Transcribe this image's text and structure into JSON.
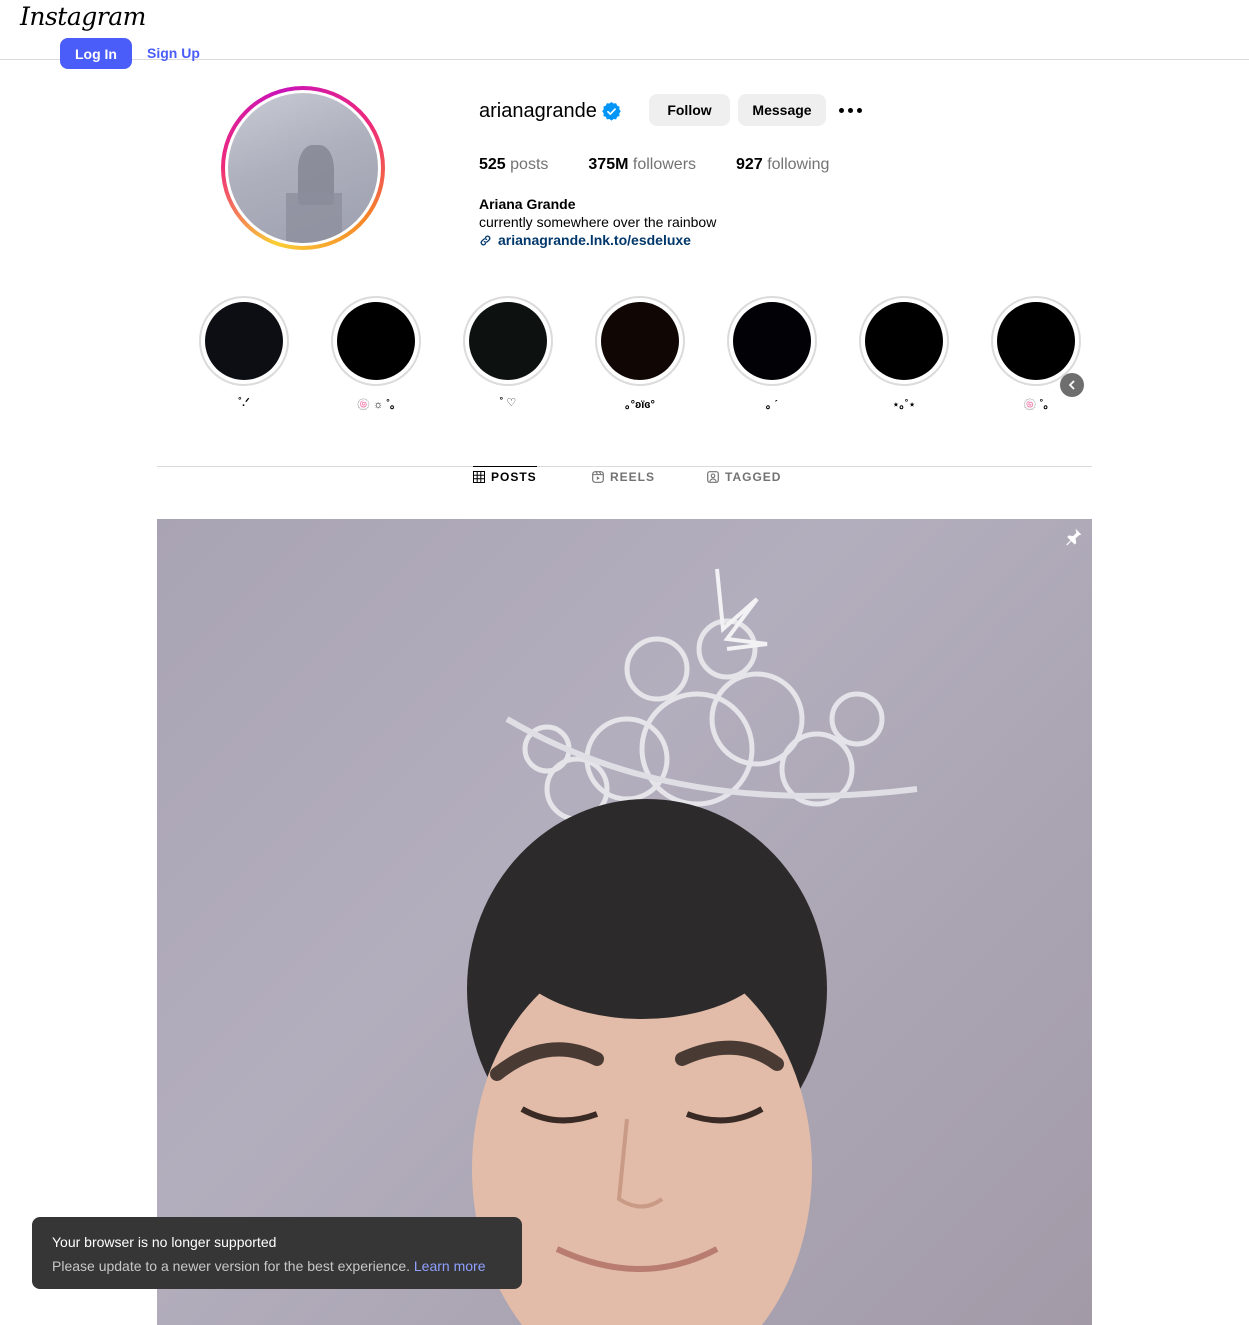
{
  "header": {
    "logo": "Instagram",
    "login_label": "Log In",
    "signup_label": "Sign Up"
  },
  "profile": {
    "username": "arianagrande",
    "follow_label": "Follow",
    "message_label": "Message",
    "stats": {
      "posts_count": "525",
      "posts_label": "posts",
      "followers_count": "375M",
      "followers_label": "followers",
      "following_count": "927",
      "following_label": "following"
    },
    "full_name": "Ariana Grande",
    "bio": "currently somewhere over the rainbow",
    "link": "arianagrande.lnk.to/esdeluxe"
  },
  "highlights": [
    {
      "label": "˚.ᐟ",
      "color": "#0c0e13"
    },
    {
      "label": "🍥 ☼ ˚｡",
      "color": "#000000"
    },
    {
      "label": "˚ ♡",
      "color": "#0d1210"
    },
    {
      "label": "｡°ʚïɞ°",
      "color": "#100604"
    },
    {
      "label": "｡ ˊ",
      "color": "#020105"
    },
    {
      "label": "⋆｡˚⋆",
      "color": "#000000"
    },
    {
      "label": "🍥 ˚｡",
      "color": "#000000"
    }
  ],
  "tabs": {
    "posts": "POSTS",
    "reels": "REELS",
    "tagged": "TAGGED"
  },
  "toast": {
    "title": "Your browser is no longer supported",
    "message": "Please update to a newer version for the best experience.",
    "link": "Learn more"
  },
  "colors": {
    "brand_blue": "#4a5df9",
    "verified_blue": "#0095f6",
    "link_color": "#00376b"
  }
}
